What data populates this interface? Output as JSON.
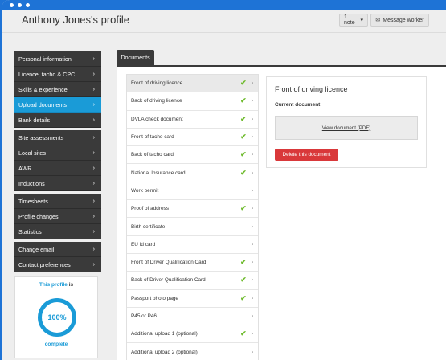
{
  "header": {
    "title": "Anthony Jones's profile",
    "note_button": "1 note",
    "message_button": "Message worker"
  },
  "sidebar": {
    "groups": [
      [
        {
          "label": "Personal information"
        },
        {
          "label": "Licence, tacho & CPC"
        },
        {
          "label": "Skills & experience"
        },
        {
          "label": "Upload documents",
          "active": true
        },
        {
          "label": "Bank details"
        }
      ],
      [
        {
          "label": "Site assessments"
        },
        {
          "label": "Local sites"
        },
        {
          "label": "AWR"
        },
        {
          "label": "Inductions"
        }
      ],
      [
        {
          "label": "Timesheets"
        },
        {
          "label": "Profile changes"
        },
        {
          "label": "Statistics"
        }
      ],
      [
        {
          "label": "Change email"
        },
        {
          "label": "Contact preferences"
        }
      ]
    ],
    "chevron": "›"
  },
  "profile_card": {
    "prefix": "This profile",
    "suffix": " is",
    "percent": "100%",
    "percent_value": 100,
    "status": "complete"
  },
  "tab": {
    "label": "Documents"
  },
  "documents": [
    {
      "label": "Front of driving licence",
      "checked": true,
      "selected": true
    },
    {
      "label": "Back of driving licence",
      "checked": true
    },
    {
      "label": "DVLA check document",
      "checked": true
    },
    {
      "label": "Front of tacho card",
      "checked": true
    },
    {
      "label": "Back of tacho card",
      "checked": true
    },
    {
      "label": "National Insurance card",
      "checked": true
    },
    {
      "label": "Work permit",
      "checked": false
    },
    {
      "label": "Proof of address",
      "checked": true
    },
    {
      "label": "Birth certificate",
      "checked": false
    },
    {
      "label": "EU Id card",
      "checked": false
    },
    {
      "label": "Front of Driver Qualification Card",
      "checked": true
    },
    {
      "label": "Back of Driver Qualification Card",
      "checked": true
    },
    {
      "label": "Passport photo page",
      "checked": true
    },
    {
      "label": "P45 or P46",
      "checked": false
    },
    {
      "label": "Additional upload 1 (optional)",
      "checked": true
    },
    {
      "label": "Additional upload 2 (optional)",
      "checked": false
    }
  ],
  "detail": {
    "title": "Front of driving licence",
    "subtitle": "Current document",
    "view_link": "View document (PDF)",
    "delete_button": "Delete this document"
  },
  "colors": {
    "accent": "#1a9bd7",
    "check": "#6fbb2e",
    "danger": "#d9383a",
    "frame": "#1e73d6"
  }
}
